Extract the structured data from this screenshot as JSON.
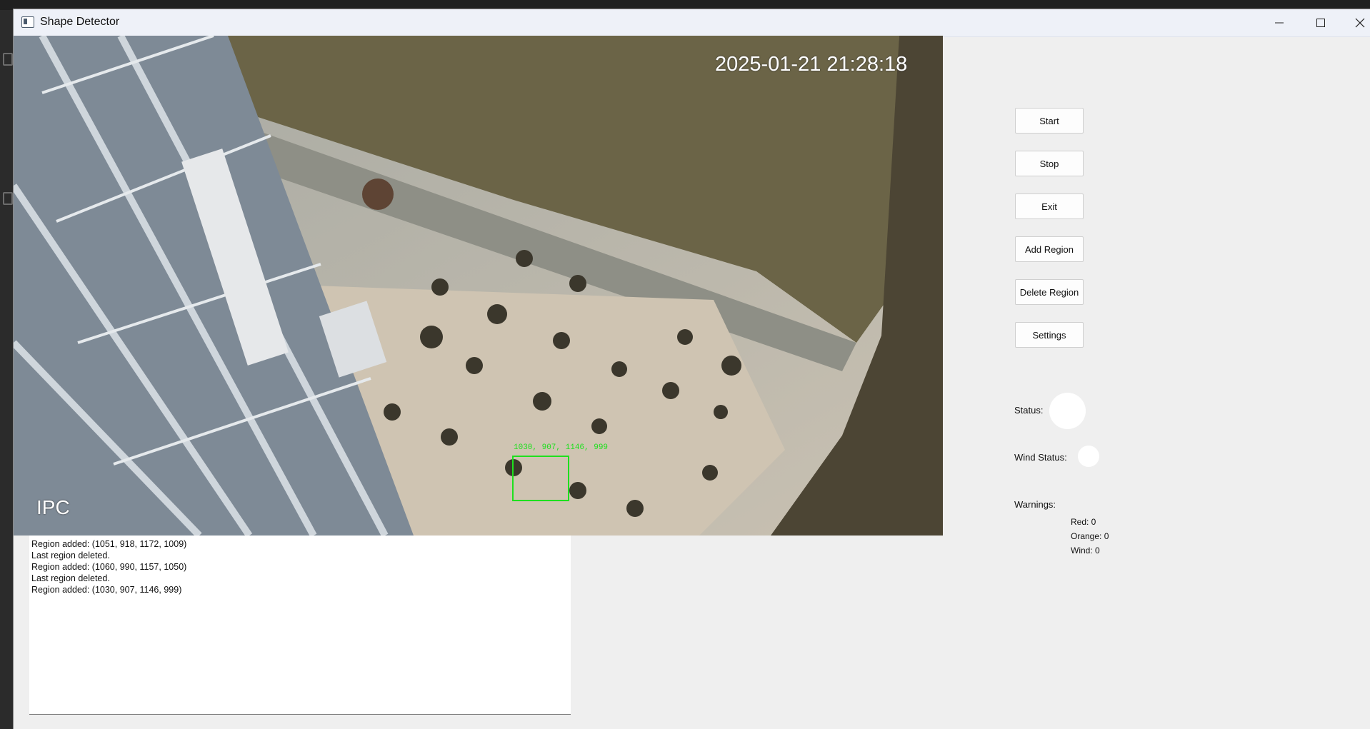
{
  "window": {
    "title": "Shape Detector",
    "icon": "app-window-icon",
    "controls": [
      "minimize-icon",
      "maximize-icon",
      "close-icon"
    ]
  },
  "video": {
    "timestamp": "2025-01-21 21:28:18",
    "camera_label": "IPC",
    "detection_label": "1030, 907, 1146, 999"
  },
  "log": {
    "lines": [
      "Region added: (1051, 918, 1172, 1009)",
      "Last region deleted.",
      "Region added: (1060, 990, 1157, 1050)",
      "Last region deleted.",
      "Region added: (1030, 907, 1146, 999)"
    ]
  },
  "controls": {
    "start": "Start",
    "stop": "Stop",
    "exit": "Exit",
    "add_region": "Add Region",
    "delete_region": "Delete Region",
    "settings": "Settings"
  },
  "status": {
    "status_label": "Status:",
    "wind_status_label": "Wind Status:",
    "indicator_color": "#ffffff"
  },
  "warnings": {
    "title": "Warnings:",
    "red": "Red: 0",
    "orange": "Orange: 0",
    "wind": "Wind: 0"
  },
  "colors": {
    "detection_box": "#1ee01e",
    "window_bg": "#efefef"
  }
}
